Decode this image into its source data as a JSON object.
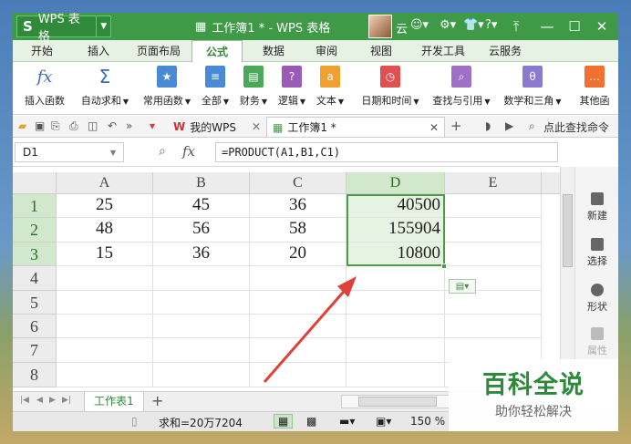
{
  "titlebar": {
    "app_label": "WPS 表格",
    "app_logo": "S",
    "doc_title": "工作簿1 * - WPS 表格",
    "user_name": "云",
    "icons": [
      "skin-icon",
      "help-icon"
    ],
    "help_label": "?"
  },
  "menu_tabs": [
    "开始",
    "插入",
    "页面布局",
    "公式",
    "数据",
    "审阅",
    "视图",
    "开发工具",
    "云服务"
  ],
  "active_tab": "公式",
  "ribbon": {
    "insert_function": "插入函数",
    "insert_function_icon": "fx",
    "autosum": "自动求和",
    "autosum_icon": "Σ",
    "common": "常用函数",
    "all": "全部",
    "finance": "财务",
    "logic": "逻辑",
    "text": "文本",
    "datetime": "日期和时间",
    "lookup": "查找与引用",
    "math": "数学和三角",
    "other": "其他函"
  },
  "quickbar": {
    "my_wps_tab": "我的WPS",
    "doc_tab": "工作簿1 *",
    "search": "点此查找命令"
  },
  "formula_bar": {
    "cell_ref": "D1",
    "fx": "fx",
    "formula": "=PRODUCT(A1,B1,C1)"
  },
  "grid": {
    "columns": [
      "A",
      "B",
      "C",
      "D",
      "E"
    ],
    "rows": [
      {
        "label": "1",
        "cells": [
          "25",
          "45",
          "36",
          "40500",
          ""
        ]
      },
      {
        "label": "2",
        "cells": [
          "48",
          "56",
          "58",
          "155904",
          ""
        ]
      },
      {
        "label": "3",
        "cells": [
          "15",
          "36",
          "20",
          "10800",
          ""
        ]
      },
      {
        "label": "4",
        "cells": [
          "",
          "",
          "",
          "",
          ""
        ]
      },
      {
        "label": "5",
        "cells": [
          "",
          "",
          "",
          "",
          ""
        ]
      },
      {
        "label": "6",
        "cells": [
          "",
          "",
          "",
          "",
          ""
        ]
      },
      {
        "label": "7",
        "cells": [
          "",
          "",
          "",
          "",
          ""
        ]
      },
      {
        "label": "8",
        "cells": [
          "",
          "",
          "",
          "",
          ""
        ]
      }
    ]
  },
  "side_panel": [
    "新建",
    "选择",
    "形状",
    "属性"
  ],
  "sheet_tab": "工作表1",
  "status": {
    "sum": "求和=20万7204",
    "zoom": "150 %"
  },
  "watermark": {
    "title": "百科全说",
    "subtitle": "助你轻松解决"
  },
  "colors": {
    "title_green": "#3f9a48",
    "selection_green": "#4c9a4a",
    "arrow_red": "#e0403a",
    "watermark_green": "#2c8a3a"
  }
}
